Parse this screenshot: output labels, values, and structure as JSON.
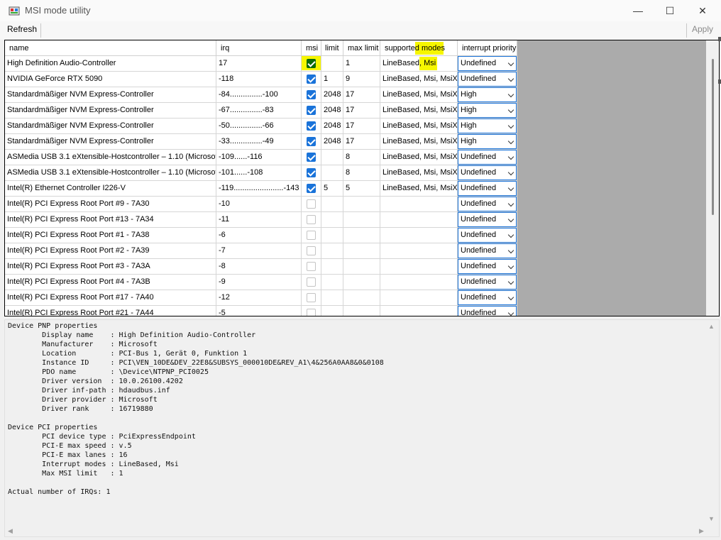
{
  "window": {
    "title": "MSI mode utility",
    "minimize": "—",
    "maximize": "☐",
    "close": "✕"
  },
  "toolbar": {
    "refresh_label": "Refresh",
    "apply_label": "Apply"
  },
  "table": {
    "headers": {
      "name": "name",
      "irq": "irq",
      "msi": "msi",
      "limit": "limit",
      "max_limit": "max limit",
      "modes": "supported modes",
      "priority": "interrupt priority"
    },
    "rows": [
      {
        "name": "High Definition Audio-Controller",
        "irq": "17",
        "msi": true,
        "limit": "",
        "max_limit": "1",
        "modes": "LineBased, Msi",
        "priority": "Undefined"
      },
      {
        "name": "NVIDIA GeForce RTX 5090",
        "irq": "-118",
        "msi": true,
        "limit": "1",
        "max_limit": "9",
        "modes": "LineBased, Msi, MsiX",
        "priority": "Undefined"
      },
      {
        "name": "Standardmäßiger NVM Express-Controller",
        "irq": "-84...............-100",
        "msi": true,
        "limit": "2048",
        "max_limit": "17",
        "modes": "LineBased, Msi, MsiX",
        "priority": "High"
      },
      {
        "name": "Standardmäßiger NVM Express-Controller",
        "irq": "-67...............-83",
        "msi": true,
        "limit": "2048",
        "max_limit": "17",
        "modes": "LineBased, Msi, MsiX",
        "priority": "High"
      },
      {
        "name": "Standardmäßiger NVM Express-Controller",
        "irq": "-50...............-66",
        "msi": true,
        "limit": "2048",
        "max_limit": "17",
        "modes": "LineBased, Msi, MsiX",
        "priority": "High"
      },
      {
        "name": "Standardmäßiger NVM Express-Controller",
        "irq": "-33...............-49",
        "msi": true,
        "limit": "2048",
        "max_limit": "17",
        "modes": "LineBased, Msi, MsiX",
        "priority": "High"
      },
      {
        "name": "ASMedia USB 3.1 eXtensible-Hostcontroller – 1.10 (Microsoft)",
        "irq": "-109......-116",
        "msi": true,
        "limit": "",
        "max_limit": "8",
        "modes": "LineBased, Msi, MsiX",
        "priority": "Undefined"
      },
      {
        "name": "ASMedia USB 3.1 eXtensible-Hostcontroller – 1.10 (Microsoft)",
        "irq": "-101......-108",
        "msi": true,
        "limit": "",
        "max_limit": "8",
        "modes": "LineBased, Msi, MsiX",
        "priority": "Undefined"
      },
      {
        "name": "Intel(R) Ethernet Controller I226-V",
        "irq": "-119.......................-143",
        "msi": true,
        "limit": "5",
        "max_limit": "5",
        "modes": "LineBased, Msi, MsiX",
        "priority": "Undefined"
      },
      {
        "name": "Intel(R) PCI Express Root Port #9 - 7A30",
        "irq": "-10",
        "msi": false,
        "limit": "",
        "max_limit": "",
        "modes": "",
        "priority": "Undefined"
      },
      {
        "name": "Intel(R) PCI Express Root Port #13 - 7A34",
        "irq": "-11",
        "msi": false,
        "limit": "",
        "max_limit": "",
        "modes": "",
        "priority": "Undefined"
      },
      {
        "name": "Intel(R) PCI Express Root Port #1 - 7A38",
        "irq": "-6",
        "msi": false,
        "limit": "",
        "max_limit": "",
        "modes": "",
        "priority": "Undefined"
      },
      {
        "name": "Intel(R) PCI Express Root Port #2 - 7A39",
        "irq": "-7",
        "msi": false,
        "limit": "",
        "max_limit": "",
        "modes": "",
        "priority": "Undefined"
      },
      {
        "name": "Intel(R) PCI Express Root Port #3 - 7A3A",
        "irq": "-8",
        "msi": false,
        "limit": "",
        "max_limit": "",
        "modes": "",
        "priority": "Undefined"
      },
      {
        "name": "Intel(R) PCI Express Root Port #4 - 7A3B",
        "irq": "-9",
        "msi": false,
        "limit": "",
        "max_limit": "",
        "modes": "",
        "priority": "Undefined"
      },
      {
        "name": "Intel(R) PCI Express Root Port #17 - 7A40",
        "irq": "-12",
        "msi": false,
        "limit": "",
        "max_limit": "",
        "modes": "",
        "priority": "Undefined"
      },
      {
        "name": "Intel(R) PCI Express Root Port #21 - 7A44",
        "irq": "-5",
        "msi": false,
        "limit": "",
        "max_limit": "",
        "modes": "",
        "priority": "Undefined"
      }
    ]
  },
  "properties": {
    "text": "Device PNP properties\n        Display name    : High Definition Audio-Controller\n        Manufacturer    : Microsoft\n        Location        : PCI-Bus 1, Gerät 0, Funktion 1\n        Instance ID     : PCI\\VEN_10DE&DEV_22E8&SUBSYS_000010DE&REV_A1\\4&256A0AA8&0&0108\n        PDO name        : \\Device\\NTPNP_PCI0025\n        Driver version  : 10.0.26100.4202\n        Driver inf-path : hdaudbus.inf\n        Driver provider : Microsoft\n        Driver rank     : 16719880\n\nDevice PCI properties\n        PCI device type : PciExpressEndpoint\n        PCI-E max speed : v.5\n        PCI-E max lanes : 16\n        Interrupt modes : LineBased, Msi\n        Max MSI limit   : 1\n\nActual number of IRQs: 1"
  },
  "icons": {
    "scroll_up": "▲",
    "scroll_down": "▼",
    "scroll_left": "◀",
    "scroll_right": "▶"
  },
  "colors": {
    "accent": "#1a73d9",
    "highlight": "#f6f600",
    "checked_highlight": "#0a6a0a"
  }
}
